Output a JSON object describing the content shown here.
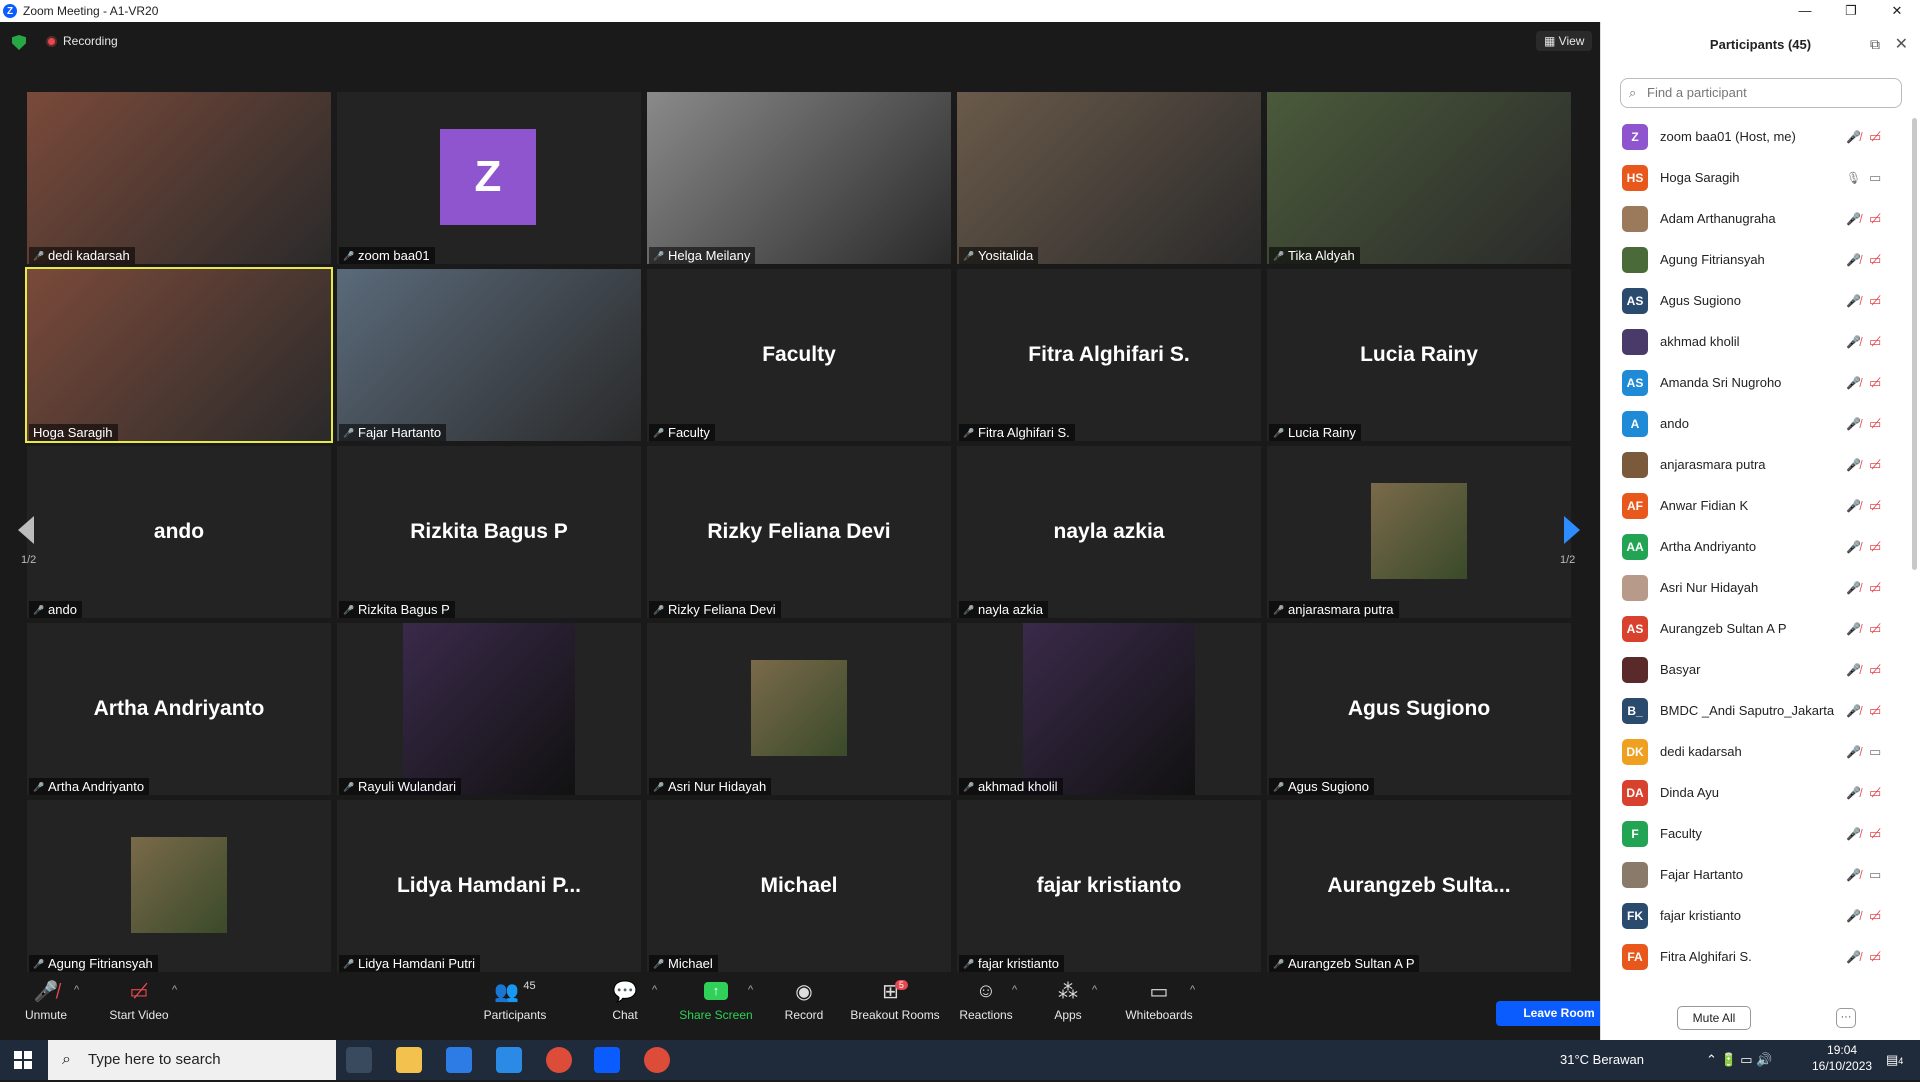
{
  "window": {
    "title": "Zoom Meeting - A1-VR20",
    "minimize": "—",
    "maximize": "❐",
    "close": "✕"
  },
  "topbar": {
    "recording": "Recording",
    "view": "View"
  },
  "tiles": [
    {
      "name": "dedi kadarsah",
      "big": "",
      "kind": "photo"
    },
    {
      "name": "zoom baa01",
      "big": "",
      "kind": "avatar",
      "initial": "Z"
    },
    {
      "name": "Helga Meilany",
      "big": "",
      "kind": "photo"
    },
    {
      "name": "Yositalida",
      "big": "",
      "kind": "photo"
    },
    {
      "name": "Tika Aldyah",
      "big": "",
      "kind": "photo"
    },
    {
      "name": "Hoga Saragih",
      "big": "",
      "kind": "photo",
      "active": true
    },
    {
      "name": "Fajar Hartanto",
      "big": "",
      "kind": "photo"
    },
    {
      "name": "Faculty",
      "big": "Faculty",
      "kind": "text"
    },
    {
      "name": "Fitra Alghifari S.",
      "big": "Fitra Alghifari S.",
      "kind": "text"
    },
    {
      "name": "Lucia Rainy",
      "big": "Lucia Rainy",
      "kind": "text"
    },
    {
      "name": "ando",
      "big": "ando",
      "kind": "text"
    },
    {
      "name": "Rizkita Bagus P",
      "big": "Rizkita Bagus P",
      "kind": "text"
    },
    {
      "name": "Rizky Feliana Devi",
      "big": "Rizky Feliana Devi",
      "kind": "text"
    },
    {
      "name": "nayla azkia",
      "big": "nayla azkia",
      "kind": "text"
    },
    {
      "name": "anjarasmara putra",
      "big": "",
      "kind": "smallphoto"
    },
    {
      "name": "Artha Andriyanto",
      "big": "Artha Andriyanto",
      "kind": "text"
    },
    {
      "name": "Rayuli Wulandari",
      "big": "",
      "kind": "widephoto"
    },
    {
      "name": "Asri Nur Hidayah",
      "big": "",
      "kind": "smallphoto"
    },
    {
      "name": "akhmad kholil",
      "big": "",
      "kind": "widephoto"
    },
    {
      "name": "Agus Sugiono",
      "big": "Agus Sugiono",
      "kind": "text"
    },
    {
      "name": "Agung Fitriansyah",
      "big": "",
      "kind": "smallphoto"
    },
    {
      "name": "Lidya Hamdani Putri",
      "big": "Lidya Hamdani P...",
      "kind": "text"
    },
    {
      "name": "Michael",
      "big": "Michael",
      "kind": "text"
    },
    {
      "name": "fajar kristianto",
      "big": "fajar kristianto",
      "kind": "text"
    },
    {
      "name": "Aurangzeb Sultan A P",
      "big": "Aurangzeb Sulta...",
      "kind": "text"
    }
  ],
  "pager": {
    "left": "1/2",
    "right": "1/2"
  },
  "toolbar": {
    "unmute": "Unmute",
    "start_video": "Start Video",
    "participants": "Participants",
    "participants_count": "45",
    "chat": "Chat",
    "share_screen": "Share Screen",
    "record": "Record",
    "breakout_rooms": "Breakout Rooms",
    "breakout_badge": "5",
    "reactions": "Reactions",
    "apps": "Apps",
    "whiteboards": "Whiteboards",
    "leave": "Leave Room"
  },
  "panel": {
    "title": "Participants (45)",
    "search_placeholder": "Find a participant",
    "mute_all": "Mute All",
    "more": "···",
    "participants": [
      {
        "name": "zoom baa01 (Host, me)",
        "initials": "Z",
        "color": "#8e55ce",
        "mic": "muted",
        "cam": "off"
      },
      {
        "name": "Hoga Saragih",
        "initials": "HS",
        "color": "#e8571c",
        "mic": "on",
        "cam": "on"
      },
      {
        "name": "Adam Arthanugraha",
        "initials": "",
        "color": "#9a7a5a",
        "mic": "muted",
        "cam": "off"
      },
      {
        "name": "Agung Fitriansyah",
        "initials": "",
        "color": "#4a6a3a",
        "mic": "muted",
        "cam": "off"
      },
      {
        "name": "Agus Sugiono",
        "initials": "AS",
        "color": "#2a4a6e",
        "mic": "muted",
        "cam": "off"
      },
      {
        "name": "akhmad kholil",
        "initials": "",
        "color": "#4a3a6a",
        "mic": "muted",
        "cam": "off"
      },
      {
        "name": "Amanda Sri Nugroho",
        "initials": "AS",
        "color": "#1f8ad6",
        "mic": "muted",
        "cam": "off"
      },
      {
        "name": "ando",
        "initials": "A",
        "color": "#1f8ad6",
        "mic": "muted",
        "cam": "off"
      },
      {
        "name": "anjarasmara putra",
        "initials": "",
        "color": "#7a5a3a",
        "mic": "muted",
        "cam": "off"
      },
      {
        "name": "Anwar Fidian K",
        "initials": "AF",
        "color": "#e8571c",
        "mic": "muted",
        "cam": "off"
      },
      {
        "name": "Artha Andriyanto",
        "initials": "AA",
        "color": "#23a455",
        "mic": "muted",
        "cam": "off"
      },
      {
        "name": "Asri Nur Hidayah",
        "initials": "",
        "color": "#b89a8a",
        "mic": "muted",
        "cam": "off"
      },
      {
        "name": "Aurangzeb Sultan A P",
        "initials": "AS",
        "color": "#d9412f",
        "mic": "muted",
        "cam": "off"
      },
      {
        "name": "Basyar",
        "initials": "",
        "color": "#5a2a2a",
        "mic": "muted",
        "cam": "off"
      },
      {
        "name": "BMDC _Andi Saputro_Jakarta",
        "initials": "B_",
        "color": "#2a4a6e",
        "mic": "muted",
        "cam": "off"
      },
      {
        "name": "dedi kadarsah",
        "initials": "DK",
        "color": "#f0a020",
        "mic": "muted",
        "cam": "on"
      },
      {
        "name": "Dinda Ayu",
        "initials": "DA",
        "color": "#d9412f",
        "mic": "muted",
        "cam": "off"
      },
      {
        "name": "Faculty",
        "initials": "F",
        "color": "#23a455",
        "mic": "muted",
        "cam": "off"
      },
      {
        "name": "Fajar Hartanto",
        "initials": "",
        "color": "#8a7a6a",
        "mic": "muted",
        "cam": "on"
      },
      {
        "name": "fajar kristianto",
        "initials": "FK",
        "color": "#2a4a6e",
        "mic": "muted",
        "cam": "off"
      },
      {
        "name": "Fitra Alghifari S.",
        "initials": "FA",
        "color": "#e8571c",
        "mic": "muted",
        "cam": "off"
      }
    ]
  },
  "taskbar": {
    "search_placeholder": "Type here to search",
    "weather": "31°C Berawan",
    "time": "19:04",
    "date": "16/10/2023",
    "notif_badge": "4"
  }
}
